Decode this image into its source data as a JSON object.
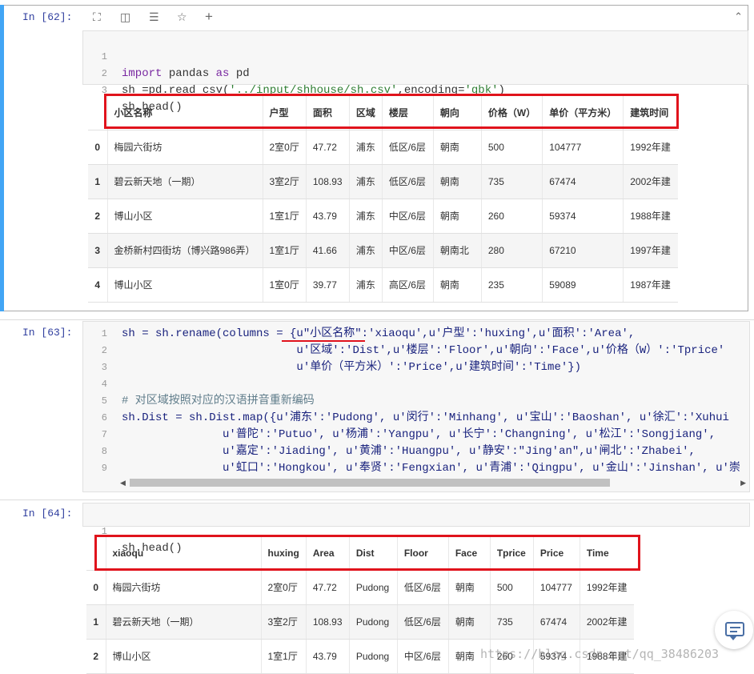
{
  "cells": [
    {
      "prompt": "In [62]:",
      "lines": [
        {
          "n": "1"
        },
        {
          "n": "2"
        },
        {
          "n": "3"
        }
      ],
      "code_1": [
        "import",
        " pandas ",
        "as",
        " pd"
      ],
      "code_2": [
        "sh =pd.read_csv(",
        "'../input/shhouse/sh.csv'",
        ",encoding=",
        "'gbk'",
        ")"
      ],
      "code_3": [
        "sh.head()"
      ],
      "table": {
        "headers": [
          "小区名称",
          "户型",
          "面积",
          "区域",
          "楼层",
          "朝向",
          "价格（W）",
          "单价（平方米）",
          "建筑时间"
        ],
        "rows": [
          [
            "0",
            "梅园六街坊",
            "2室0厅",
            "47.72",
            "浦东",
            "低区/6层",
            "朝南",
            "500",
            "104777",
            "1992年建"
          ],
          [
            "1",
            "碧云新天地（一期）",
            "3室2厅",
            "108.93",
            "浦东",
            "低区/6层",
            "朝南",
            "735",
            "67474",
            "2002年建"
          ],
          [
            "2",
            "博山小区",
            "1室1厅",
            "43.79",
            "浦东",
            "中区/6层",
            "朝南",
            "260",
            "59374",
            "1988年建"
          ],
          [
            "3",
            "金桥新村四街坊（博兴路986弄）",
            "1室1厅",
            "41.66",
            "浦东",
            "中区/6层",
            "朝南北",
            "280",
            "67210",
            "1997年建"
          ],
          [
            "4",
            "博山小区",
            "1室0厅",
            "39.77",
            "浦东",
            "高区/6层",
            "朝南",
            "235",
            "59089",
            "1987年建"
          ]
        ]
      }
    },
    {
      "prompt": "In [63]:",
      "line_numbers": [
        "1",
        "2",
        "3",
        "4",
        "5",
        "6",
        "7",
        "8",
        "9"
      ],
      "code": [
        "sh = sh.rename(columns = {u\"小区名称\":'xiaoqu',u'户型':'huxing',u'面积':'Area',",
        "                          u'区域':'Dist',u'楼层':'Floor',u'朝向':'Face',u'价格（W）':'Tprice'",
        "                          u'单价（平方米）':'Price',u'建筑时间':'Time'})",
        "",
        "# 对区域按照对应的汉语拼音重新编码",
        "sh.Dist = sh.Dist.map({u'浦东':'Pudong', u'闵行':'Minhang', u'宝山':'Baoshan', u'徐汇':'Xuhui",
        "               u'普陀':'Putuo', u'杨浦':'Yangpu', u'长宁':'Changning', u'松江':'Songjiang',",
        "               u'嘉定':'Jiading', u'黄浦':'Huangpu', u'静安':\"Jing'an\",u'闸北':'Zhabei',",
        "               u'虹口':'Hongkou', u'奉贤':'Fengxian', u'青浦':'Qingpu', u'金山':'Jinshan', u'崇"
      ]
    },
    {
      "prompt": "In [64]:",
      "line_numbers": [
        "1"
      ],
      "code": [
        "sh.head()"
      ],
      "table": {
        "headers": [
          "xiaoqu",
          "huxing",
          "Area",
          "Dist",
          "Floor",
          "Face",
          "Tprice",
          "Price",
          "Time"
        ],
        "rows": [
          [
            "0",
            "梅园六街坊",
            "2室0厅",
            "47.72",
            "Pudong",
            "低区/6层",
            "朝南",
            "500",
            "104777",
            "1992年建"
          ],
          [
            "1",
            "碧云新天地（一期）",
            "3室2厅",
            "108.93",
            "Pudong",
            "低区/6层",
            "朝南",
            "735",
            "67474",
            "2002年建"
          ],
          [
            "2",
            "博山小区",
            "1室1厅",
            "43.79",
            "Pudong",
            "中区/6层",
            "朝南",
            "260",
            "59374",
            "1988年建"
          ]
        ]
      }
    }
  ],
  "toolbar": {
    "icons": [
      "expand-icon",
      "split-icon",
      "indent-icon",
      "star-icon",
      "plus-icon"
    ],
    "glyphs": [
      "⛶",
      "◫",
      "☰",
      "☆",
      "+"
    ],
    "collapse_glyph": "⌃"
  },
  "scroll": {
    "left": "◀",
    "right": "▶"
  },
  "watermark": "https://blog.csdn.net/qq_38486203",
  "colors": {
    "accent": "#42a5f5",
    "highlight": "#e0131c"
  }
}
